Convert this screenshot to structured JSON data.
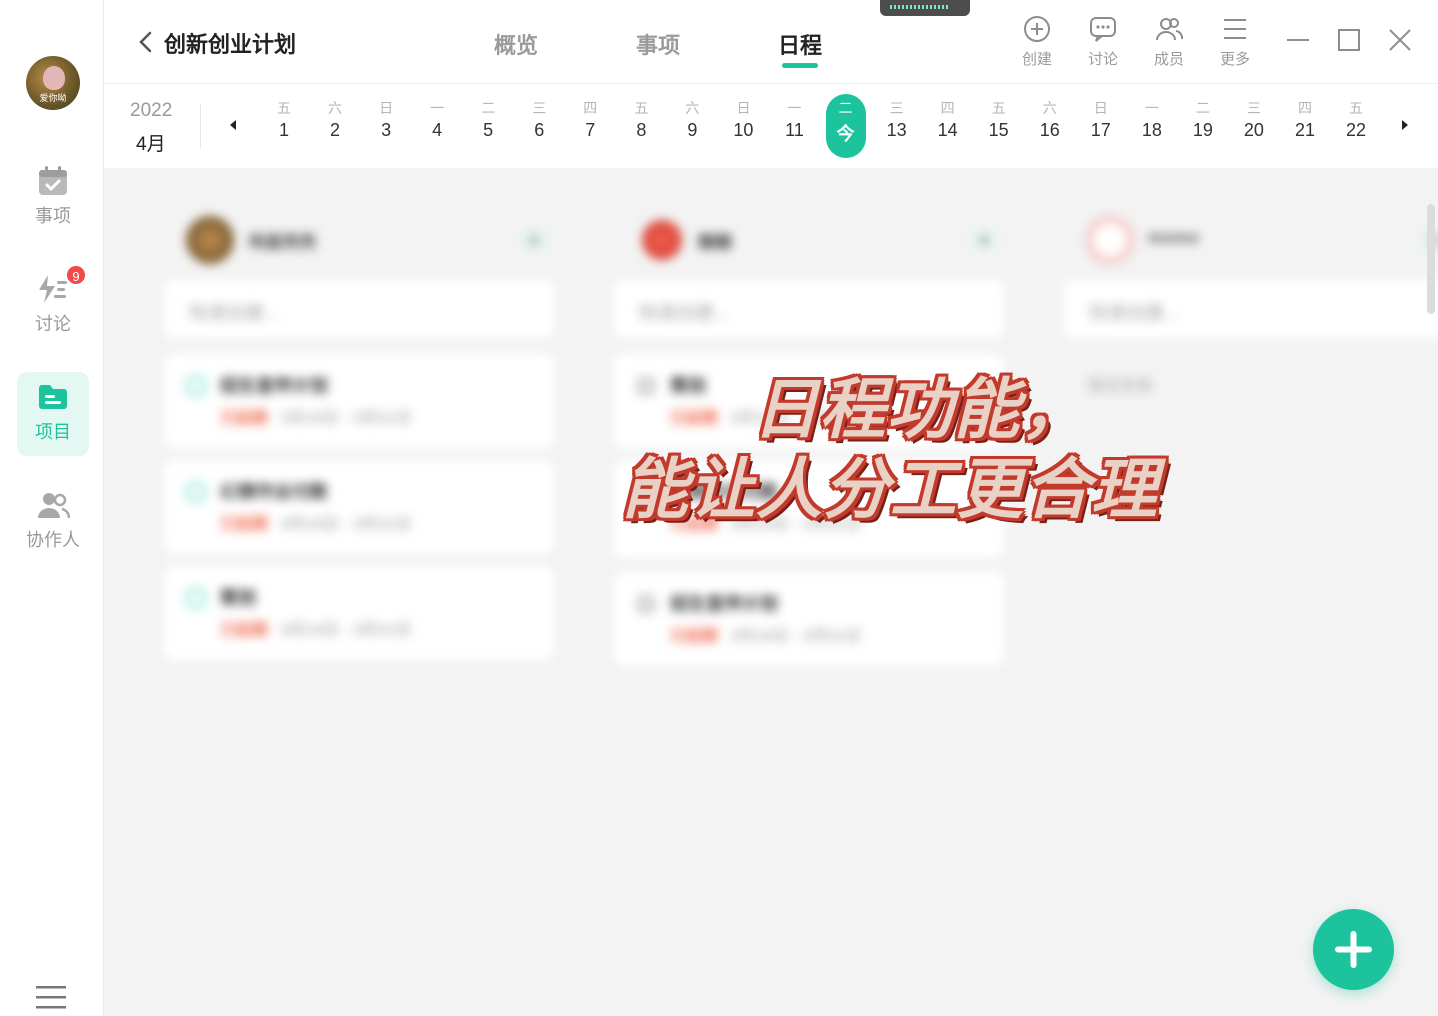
{
  "sidebar": {
    "avatar_caption": "爱你呦",
    "items": [
      {
        "label": "事项",
        "icon": "calendar-check-icon",
        "badge": null,
        "active": false
      },
      {
        "label": "讨论",
        "icon": "lightning-list-icon",
        "badge": "9",
        "active": false
      },
      {
        "label": "项目",
        "icon": "folder-icon",
        "badge": null,
        "active": true
      },
      {
        "label": "协作人",
        "icon": "people-icon",
        "badge": null,
        "active": false
      }
    ]
  },
  "header": {
    "title": "创新创业计划",
    "tabs": [
      {
        "label": "概览",
        "active": false
      },
      {
        "label": "事项",
        "active": false
      },
      {
        "label": "日程",
        "active": true
      }
    ],
    "tools": [
      {
        "label": "创建",
        "icon": "plus-circle-icon"
      },
      {
        "label": "讨论",
        "icon": "chat-bubble-icon"
      },
      {
        "label": "成员",
        "icon": "members-icon"
      },
      {
        "label": "更多",
        "icon": "menu-lines-icon"
      }
    ]
  },
  "datebar": {
    "year": "2022",
    "month": "4月",
    "days": [
      {
        "wd": "五",
        "dn": "1"
      },
      {
        "wd": "六",
        "dn": "2"
      },
      {
        "wd": "日",
        "dn": "3"
      },
      {
        "wd": "一",
        "dn": "4"
      },
      {
        "wd": "二",
        "dn": "5"
      },
      {
        "wd": "三",
        "dn": "6"
      },
      {
        "wd": "四",
        "dn": "7"
      },
      {
        "wd": "五",
        "dn": "8"
      },
      {
        "wd": "六",
        "dn": "9"
      },
      {
        "wd": "日",
        "dn": "10"
      },
      {
        "wd": "一",
        "dn": "11"
      },
      {
        "wd": "二",
        "dn": "今",
        "today": true
      },
      {
        "wd": "三",
        "dn": "13"
      },
      {
        "wd": "四",
        "dn": "14"
      },
      {
        "wd": "五",
        "dn": "15"
      },
      {
        "wd": "六",
        "dn": "16"
      },
      {
        "wd": "日",
        "dn": "17"
      },
      {
        "wd": "一",
        "dn": "18"
      },
      {
        "wd": "二",
        "dn": "19"
      },
      {
        "wd": "三",
        "dn": "20"
      },
      {
        "wd": "四",
        "dn": "21"
      },
      {
        "wd": "五",
        "dn": "22"
      }
    ]
  },
  "columns": [
    {
      "name": "鸡蛋壳壳",
      "count": "0",
      "quick_placeholder": "快速创建...",
      "cards": [
        {
          "title": "招生宣传计划",
          "tag": "已延期",
          "date": "3月16日 - 3月31日"
        },
        {
          "title": "幻想作业付款",
          "tag": "已延期",
          "date": "3月16日 - 3月31日"
        },
        {
          "title": "策划",
          "tag": "已延期",
          "date": "3月16日 - 3月31日"
        }
      ]
    },
    {
      "name": "糖糖",
      "count": "0",
      "quick_placeholder": "快速创建...",
      "cards": [
        {
          "title": "策划",
          "tag": "已延期",
          "date": "3月16日 - 3月31日"
        },
        {
          "title": "幻想作业付款",
          "tag": "已延期",
          "date": "3月16日 - 3月31日"
        },
        {
          "title": "招生宣传计划",
          "tag": "已延期",
          "date": "3月16日 - 3月31日"
        }
      ]
    },
    {
      "name": "momo",
      "count": "0",
      "quick_placeholder": "快速创建...",
      "empty_text": "暂无安排",
      "cards": []
    }
  ],
  "overlay": {
    "line1": "日程功能，",
    "line2": "能让人分工更合理"
  },
  "colors": {
    "accent": "#1cc39c",
    "badge": "#f24a4a",
    "overdue": "#f06b52"
  }
}
